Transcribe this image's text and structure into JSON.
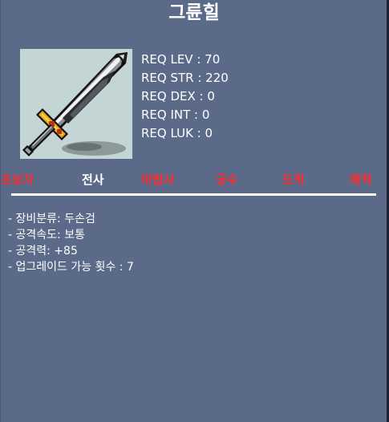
{
  "item": {
    "name": "그륜힐",
    "icon": "sword-icon"
  },
  "requirements": [
    {
      "label": "REQ LEV : 70"
    },
    {
      "label": "REQ STR : 220"
    },
    {
      "label": "REQ DEX : 0"
    },
    {
      "label": "REQ INT : 0"
    },
    {
      "label": "REQ LUK : 0"
    }
  ],
  "jobs": [
    {
      "label": "초보자",
      "color": "#ff2a2a"
    },
    {
      "label": "전사",
      "color": "#ffffff"
    },
    {
      "label": "마법사",
      "color": "#ff2a2a"
    },
    {
      "label": "궁수",
      "color": "#ff2a2a"
    },
    {
      "label": "도적",
      "color": "#ff2a2a"
    },
    {
      "label": "해적",
      "color": "#ff2a2a"
    }
  ],
  "properties": [
    {
      "text": "- 장비분류: 두손검"
    },
    {
      "text": "- 공격속도: 보통"
    },
    {
      "text": "- 공격력: +85"
    },
    {
      "text": "- 업그레이드 가능 횟수 : 7"
    }
  ],
  "colors": {
    "panel_bg": "#5a6a88",
    "icon_bg": "#c4d5d5",
    "text": "#ffffff",
    "job_unavailable": "#ff2a2a",
    "job_available": "#ffffff"
  }
}
